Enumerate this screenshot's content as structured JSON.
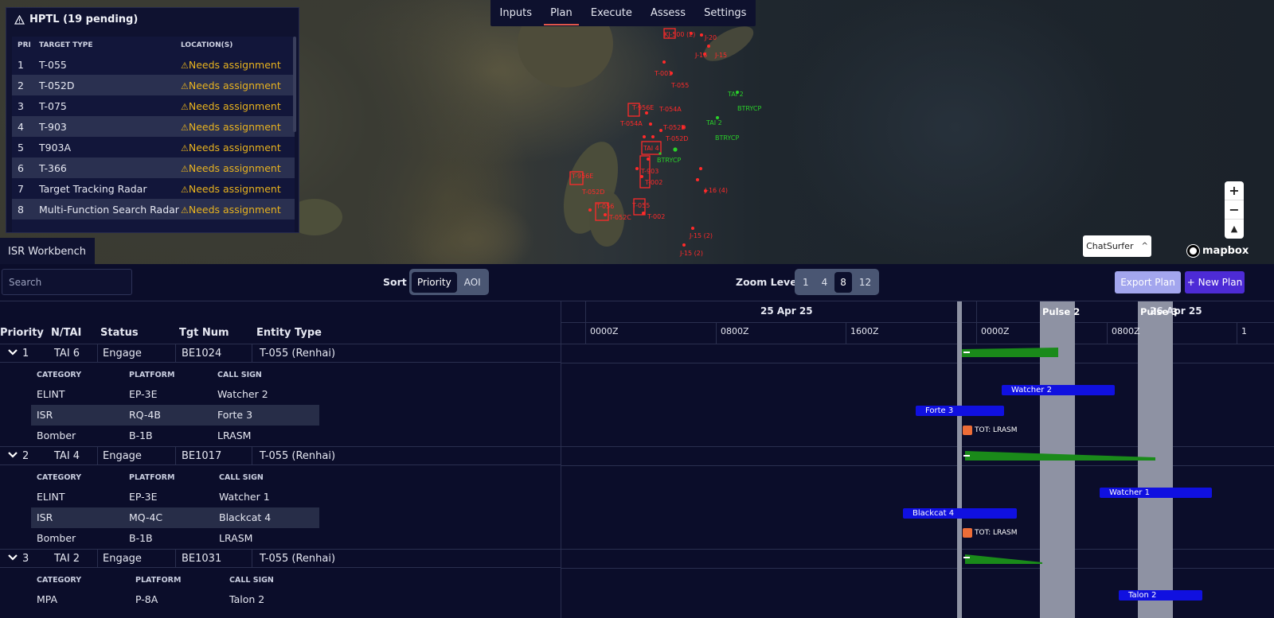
{
  "nav": {
    "tabs": [
      "Inputs",
      "Plan",
      "Execute",
      "Assess",
      "Settings"
    ],
    "active": "Plan"
  },
  "hptl": {
    "title": "HPTL (19 pending)",
    "headers": {
      "pri": "PRI",
      "type": "TARGET TYPE",
      "loc": "LOCATION(S)"
    },
    "rows": [
      {
        "pri": "1",
        "type": "T-055",
        "loc": "Needs assignment"
      },
      {
        "pri": "2",
        "type": "T-052D",
        "loc": "Needs assignment"
      },
      {
        "pri": "3",
        "type": "T-075",
        "loc": "Needs assignment"
      },
      {
        "pri": "4",
        "type": "T-903",
        "loc": "Needs assignment"
      },
      {
        "pri": "5",
        "type": "T903A",
        "loc": "Needs assignment"
      },
      {
        "pri": "6",
        "type": "T-366",
        "loc": "Needs assignment"
      },
      {
        "pri": "7",
        "type": "Target Tracking Radar",
        "loc": "Needs assignment"
      },
      {
        "pri": "8",
        "type": "Multi-Function Search Radar",
        "loc": "Needs assignment"
      }
    ]
  },
  "map": {
    "labels_red": [
      "KJ-500 (2)",
      "J-20",
      "J-16",
      "J-15",
      "T-001",
      "T-055",
      "T-956E",
      "T-054A",
      "T-054A",
      "T-052D",
      "T-052D",
      "TAI 4",
      "T-903",
      "T-002",
      "T-956E",
      "T-052D",
      "T-056",
      "T-052C",
      "T-055",
      "T-002",
      "J-16 (4)",
      "J-15 (2)",
      "J-15 (2)"
    ],
    "labels_green": [
      "TAI 2",
      "BTRYCP",
      "TAI 2",
      "BTRYCP",
      "BTRYCP"
    ],
    "zoom_in": "+",
    "zoom_out": "−",
    "compass": "▲",
    "chatsurfer": "ChatSurfer",
    "chatsurfer_chev": "^",
    "mapbox": "mapbox"
  },
  "workbench": {
    "tab_label": "ISR Workbench",
    "search_placeholder": "Search",
    "sort_label": "Sort",
    "sort_options": [
      "Priority",
      "AOI"
    ],
    "sort_selected": "Priority",
    "zoom_label": "Zoom Level",
    "zoom_options": [
      "1",
      "4",
      "8",
      "12"
    ],
    "zoom_selected": "8",
    "export_label": "Export Plan",
    "new_plan_label": "+ New Plan",
    "columns": {
      "priority": "Priority",
      "ntai": "N/TAI",
      "status": "Status",
      "tgt": "Tgt Num",
      "entity": "Entity Type"
    },
    "sub_headers": {
      "category": "CATEGORY",
      "platform": "PLATFORM",
      "callsign": "CALL SIGN"
    },
    "groups": [
      {
        "pri": "1",
        "tai": "TAI 6",
        "status": "Engage",
        "tgt": "BE1024",
        "entity": "T-055 (Renhai)",
        "assets": [
          {
            "category": "ELINT",
            "platform": "EP-3E",
            "callsign": "Watcher 2"
          },
          {
            "category": "ISR",
            "platform": "RQ-4B",
            "callsign": "Forte 3"
          },
          {
            "category": "Bomber",
            "platform": "B-1B",
            "callsign": "LRASM"
          }
        ]
      },
      {
        "pri": "2",
        "tai": "TAI 4",
        "status": "Engage",
        "tgt": "BE1017",
        "entity": "T-055 (Renhai)",
        "assets": [
          {
            "category": "ELINT",
            "platform": "EP-3E",
            "callsign": "Watcher 1"
          },
          {
            "category": "ISR",
            "platform": "MQ-4C",
            "callsign": "Blackcat 4"
          },
          {
            "category": "Bomber",
            "platform": "B-1B",
            "callsign": "LRASM"
          }
        ]
      },
      {
        "pri": "3",
        "tai": "TAI 2",
        "status": "Engage",
        "tgt": "BE1031",
        "entity": "T-055 (Renhai)",
        "assets": [
          {
            "category": "MPA",
            "platform": "P-8A",
            "callsign": "Talon 2"
          }
        ]
      }
    ]
  },
  "timeline": {
    "dates": [
      "25 Apr 25",
      "26 Apr 25"
    ],
    "ticks": [
      "0000Z",
      "0800Z",
      "1600Z",
      "0000Z",
      "0800Z",
      "1"
    ],
    "pulses": [
      "Pulse 2",
      "Pulse 3"
    ],
    "bars": {
      "g1_blue_a": "Watcher 2",
      "g1_blue_b": "Forte 3",
      "g1_tot": "TOT: LRASM",
      "g2_blue_a": "Watcher 1",
      "g2_blue_b": "Blackcat 4",
      "g2_tot": "TOT: LRASM",
      "g3_blue_a": "Talon 2"
    },
    "colors": {
      "engage": "#1a8a1a",
      "asset": "#1010e0",
      "tot": "#ee6d37",
      "pulse": "#8e92a3"
    }
  }
}
